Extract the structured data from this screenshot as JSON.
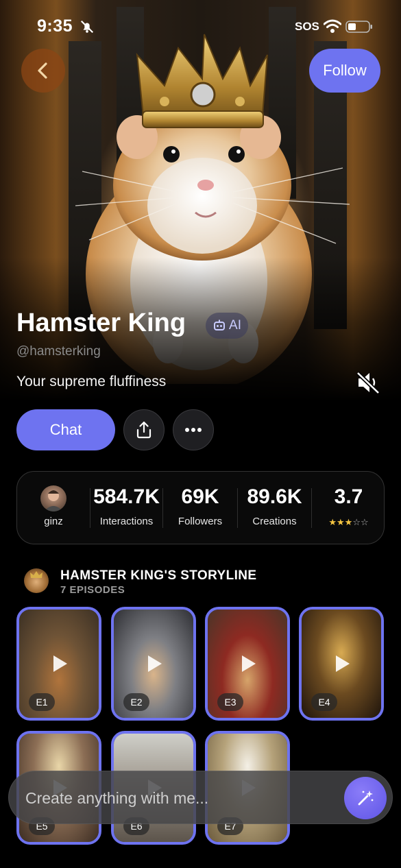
{
  "status_bar": {
    "time": "9:35",
    "carrier": "SOS",
    "icons": [
      "bell-slash-icon",
      "wifi-icon",
      "battery-icon"
    ]
  },
  "header": {
    "back_icon": "chevron-left-icon",
    "follow_label": "Follow"
  },
  "profile": {
    "name": "Hamster King",
    "ai_badge": "AI",
    "handle": "@hamsterking",
    "tagline": "Your supreme fluffiness",
    "mute_icon": "speaker-muted-icon"
  },
  "actions": {
    "chat_label": "Chat",
    "share_icon": "share-icon",
    "more_icon": "more-dots-icon"
  },
  "stats": {
    "creator": "ginz",
    "interactions": {
      "value": "584.7K",
      "label": "Interactions"
    },
    "followers": {
      "value": "69K",
      "label": "Followers"
    },
    "creations": {
      "value": "89.6K",
      "label": "Creations"
    },
    "rating": {
      "value": "3.7",
      "stars": 3,
      "max_stars": 5
    }
  },
  "storyline": {
    "title": "HAMSTER KING'S STORYLINE",
    "subtitle": "7 EPISODES",
    "episodes": [
      {
        "label": "E1"
      },
      {
        "label": "E2"
      },
      {
        "label": "E3"
      },
      {
        "label": "E4"
      },
      {
        "label": "E5"
      },
      {
        "label": "E6"
      },
      {
        "label": "E7"
      }
    ]
  },
  "create_bar": {
    "placeholder": "Create anything with me...",
    "button_icon": "magic-wand-icon"
  },
  "colors": {
    "accent": "#6e73f0",
    "background": "#000000",
    "back_button": "#8c4614"
  }
}
